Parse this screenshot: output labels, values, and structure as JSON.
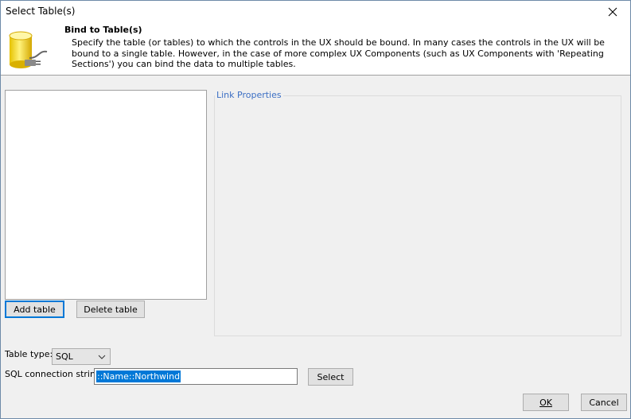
{
  "window": {
    "title": "Select Table(s)"
  },
  "header": {
    "title": "Bind to Table(s)",
    "description": "Specify the table (or tables) to which the controls in the UX should be bound. In many cases the controls in the UX will be bound to a single table. However, in the case of more complex UX Components (such as UX Components with 'Repeating Sections') you can bind the data to multiple tables.",
    "icon": "database-plug-icon"
  },
  "tables": {
    "items": []
  },
  "buttons": {
    "add_table": "Add table",
    "delete_table": "Delete table",
    "select": "Select",
    "ok": "OK",
    "cancel": "Cancel"
  },
  "link_properties": {
    "label": "Link Properties"
  },
  "table_type": {
    "label": "Table type:",
    "selected": "SQL"
  },
  "connection": {
    "label": "SQL connection string:",
    "value": "::Name::Northwind"
  },
  "colors": {
    "accent": "#0078d7",
    "group_label": "#3c6fc4"
  }
}
